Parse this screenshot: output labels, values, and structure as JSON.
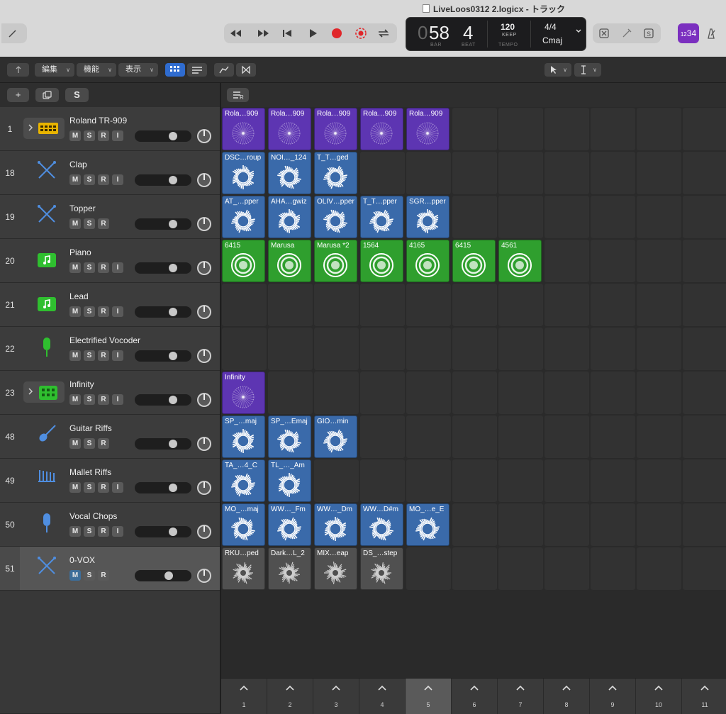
{
  "window": {
    "title": "LiveLoos0312 2.logicx - トラック"
  },
  "lcd": {
    "bar": "58",
    "beat": "4",
    "bar_prefix": "0",
    "bar_label": "BAR",
    "beat_label": "BEAT",
    "tempo": "120",
    "keep": "KEEP",
    "tempo_label": "TEMPO",
    "signature": "4/4",
    "key": "Cmaj"
  },
  "counter": {
    "main": "34",
    "prefix": "12"
  },
  "toolbar": {
    "edit": "編集",
    "function": "機能",
    "view": "表示"
  },
  "header": {
    "add": "+",
    "solo": "S"
  },
  "colors": {
    "purple": "#5d35b2",
    "blue": "#3a6aaa",
    "green": "#2f9f2e",
    "gray": "#505050"
  },
  "tracks": [
    {
      "num": "1",
      "name": "Roland TR-909",
      "icon": "drum-machine-icon",
      "mute_active": false,
      "has_R": true,
      "has_I": true,
      "disclosure": true
    },
    {
      "num": "18",
      "name": "Clap",
      "icon": "drumsticks-icon",
      "mute_active": false,
      "has_R": true,
      "has_I": true,
      "disclosure": false
    },
    {
      "num": "19",
      "name": "Topper",
      "icon": "drumsticks-icon",
      "mute_active": false,
      "has_R": true,
      "has_I": false,
      "disclosure": false
    },
    {
      "num": "20",
      "name": "Piano",
      "icon": "midi-note-icon",
      "mute_active": false,
      "has_R": true,
      "has_I": true,
      "disclosure": false
    },
    {
      "num": "21",
      "name": "Lead",
      "icon": "midi-note-icon",
      "mute_active": false,
      "has_R": true,
      "has_I": true,
      "disclosure": false
    },
    {
      "num": "22",
      "name": "Electrified Vocoder",
      "icon": "green-mic-icon",
      "mute_active": false,
      "has_R": true,
      "has_I": true,
      "disclosure": false
    },
    {
      "num": "23",
      "name": "Infinity",
      "icon": "sampler-pad-icon",
      "mute_active": false,
      "has_R": true,
      "has_I": true,
      "disclosure": true
    },
    {
      "num": "48",
      "name": "Guitar Riffs",
      "icon": "guitar-icon",
      "mute_active": false,
      "has_R": true,
      "has_I": false,
      "disclosure": false
    },
    {
      "num": "49",
      "name": "Mallet Riffs",
      "icon": "mallet-icon",
      "mute_active": false,
      "has_R": true,
      "has_I": true,
      "disclosure": false
    },
    {
      "num": "50",
      "name": "Vocal Chops",
      "icon": "blue-mic-icon",
      "mute_active": false,
      "has_R": true,
      "has_I": true,
      "disclosure": false
    },
    {
      "num": "51",
      "name": "0-VOX",
      "icon": "drumsticks-icon",
      "mute_active": true,
      "has_R": true,
      "has_I": false,
      "disclosure": false,
      "selected": true
    }
  ],
  "clips": [
    [
      "Rola…909",
      "Rola…909",
      "Rola…909",
      "Rola…909",
      "Rola…909"
    ],
    [
      "DSC…roup",
      "NOI…_124",
      "T_T…ged"
    ],
    [
      "AT_…pper",
      "AHA…gwiz",
      "OLIV…pper",
      "T_T…pper",
      "SGR…pper"
    ],
    [
      "6415",
      "Marusa",
      "Marusa *2",
      "1564",
      "4165",
      "6415",
      "4561"
    ],
    [],
    [],
    [
      "Infinity"
    ],
    [
      "SP_…maj",
      "SP_…Emaj",
      "GIO…min"
    ],
    [
      "TA_…4_C",
      "TL_…_Am"
    ],
    [
      "MO_…maj",
      "WW…_Fm",
      "WW…_Dm",
      "WW…D#m",
      "MO_…e_E"
    ],
    [
      "RKU…ped",
      "Dark…L_2",
      "MIX…eap",
      "DS_…step"
    ]
  ],
  "clip_colors": [
    "purple",
    "blue",
    "blue",
    "green",
    "",
    "",
    "purple",
    "blue",
    "blue",
    "blue",
    "gray"
  ],
  "scenes": [
    "1",
    "2",
    "3",
    "4",
    "5",
    "6",
    "7",
    "8",
    "9",
    "10",
    "11"
  ],
  "highlighted_scene": "5"
}
